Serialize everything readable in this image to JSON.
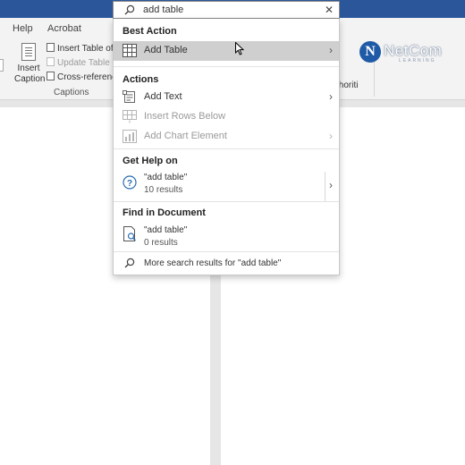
{
  "ribbon": {
    "tabs": [
      "Help",
      "Acrobat"
    ],
    "insert_caption_line1": "Insert",
    "insert_caption_line2": "Caption",
    "insert_table_of_figures": "Insert Table of Fig",
    "update_table": "Update Table",
    "cross_reference": "Cross-reference",
    "group_label": "Captions",
    "clipped_text": "thoriti"
  },
  "logo": {
    "letter": "N",
    "text": "NetCom",
    "subtext": "LEARNING"
  },
  "search": {
    "value": "add table",
    "close_glyph": "✕"
  },
  "dropdown": {
    "best_action_heading": "Best Action",
    "best_action": {
      "label": "Add Table",
      "icon": "table-icon"
    },
    "actions_heading": "Actions",
    "actions": [
      {
        "label": "Add Text",
        "icon": "add-text-icon",
        "enabled": true,
        "has_submenu": true
      },
      {
        "label": "Insert Rows Below",
        "icon": "insert-rows-icon",
        "enabled": false,
        "has_submenu": false
      },
      {
        "label": "Add Chart Element",
        "icon": "chart-element-icon",
        "enabled": false,
        "has_submenu": true
      }
    ],
    "get_help_heading": "Get Help on",
    "help_result": {
      "query": "\"add table\"",
      "count": "10 results",
      "icon": "help-icon"
    },
    "find_heading": "Find in Document",
    "find_result": {
      "query": "\"add table\"",
      "count": "0 results",
      "icon": "find-document-icon"
    },
    "more_results": "More search results for \"add table\""
  },
  "colors": {
    "title_bar": "#2b579a",
    "ribbon_bg": "#f3f3f3",
    "selected_row": "#cfcfcf",
    "disabled_text": "#9a9a9a",
    "logo_blue": "#1f5aa6"
  }
}
